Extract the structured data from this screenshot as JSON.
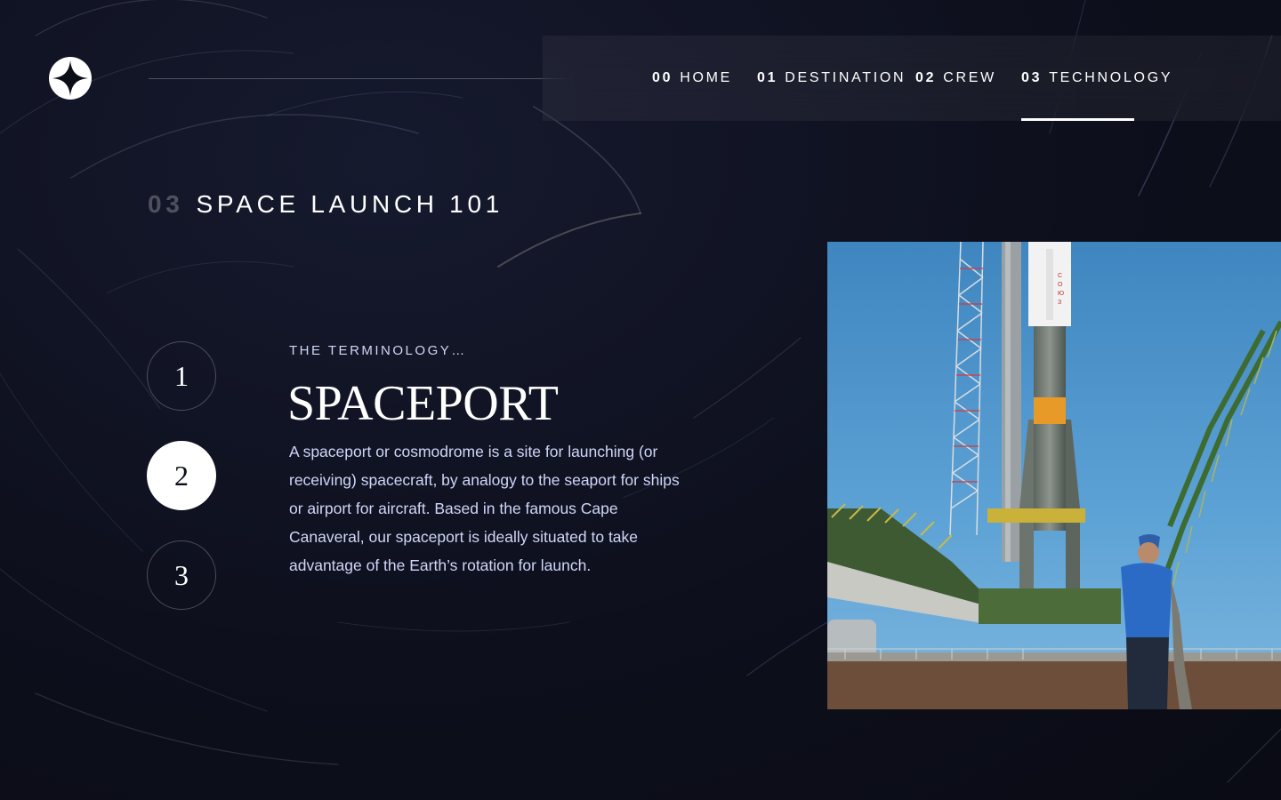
{
  "nav": {
    "items": [
      {
        "num": "00",
        "label": "HOME"
      },
      {
        "num": "01",
        "label": "DESTINATION"
      },
      {
        "num": "02",
        "label": "CREW"
      },
      {
        "num": "03",
        "label": "TECHNOLOGY"
      }
    ],
    "active_index": 3
  },
  "page": {
    "heading_num": "03",
    "heading": "SPACE LAUNCH 101"
  },
  "steps": {
    "items": [
      "1",
      "2",
      "3"
    ],
    "active_index": 1
  },
  "content": {
    "label": "THE TERMINOLOGY…",
    "title": "SPACEPORT",
    "description": "A spaceport or cosmodrome is a site for launching (or receiving) spacecraft, by analogy to the seaport for ships or airport for aircraft. Based in the famous Cape Canaveral, our spaceport is ideally situated to take advantage of the Earth’s rotation for launch."
  },
  "colors": {
    "background": "#0b0d17",
    "accent_light": "#d0d6f9",
    "white": "#ffffff"
  },
  "icons": {
    "logo": "star-logo-icon"
  }
}
